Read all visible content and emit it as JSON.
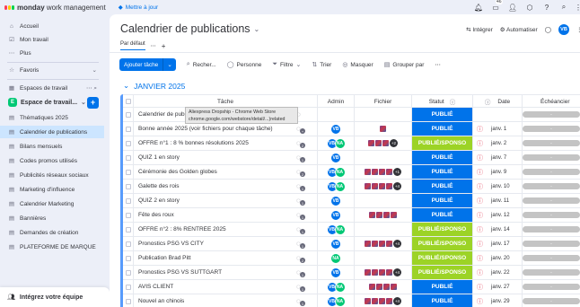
{
  "app": {
    "brand": "monday",
    "brand_suffix": "work management",
    "upgrade": "Mettre à jour",
    "inbox_count": "46"
  },
  "sidebar": {
    "top": [
      {
        "label": "Accueil",
        "icon": "home-icon"
      },
      {
        "label": "Mon travail",
        "icon": "calendar-check-icon"
      },
      {
        "label": "Plus",
        "icon": "more-icon"
      }
    ],
    "favorites": "Favoris",
    "workspaces": "Espaces de travail",
    "workspace_name": "Espace de travail...",
    "workspace_letter": "E",
    "boards": [
      "Thématiques 2025",
      "Calendrier de publications",
      "Bilans mensuels",
      "Codes promos utilisés",
      "Publicités réseaux sociaux",
      "Marketing d'influence",
      "Calendrier Marketing",
      "Bannières",
      "Demandes de création",
      "PLATEFORME DE MARQUE"
    ],
    "active_index": 1,
    "integrate": "Intégrez votre équipe"
  },
  "board": {
    "title": "Calendrier de publications",
    "integrate": "Intégrer",
    "automate": "Automatiser",
    "user_initials": "VB",
    "view_tab": "Par défaut",
    "add_item": "Ajouter tâche",
    "search": "Recher...",
    "person": "Personne",
    "filter": "Filtre",
    "sort": "Trier",
    "hide": "Masquer",
    "group_by": "Grouper par",
    "group_title": "JANVIER 2025",
    "columns": {
      "task": "Tâche",
      "admin": "Admin",
      "file": "Fichier",
      "status": "Statut",
      "date": "Date",
      "timeline": "Échéancier"
    }
  },
  "tooltip": {
    "line1": "Aliexpress Dropship - Chrome Web Store",
    "line2": "chrome.google.com/webstore/detail/...)related"
  },
  "rows": [
    {
      "task": "Calendrier de publications 2025(voir fichiers)",
      "admin": [],
      "files": 0,
      "extra": "",
      "status": "PUBLIÉ",
      "kind": "pub",
      "date": "",
      "updates": ""
    },
    {
      "task": "Bonne année 2025 (voir fichiers pour chaque tâche)",
      "admin": [
        "VB"
      ],
      "files": 1,
      "extra": "",
      "status": "PUBLIÉ",
      "kind": "pub",
      "date": "janv. 1",
      "updates": "+"
    },
    {
      "task": "OFFRE n°1 : 8 % bonnes résolutions 2025",
      "admin": [
        "VB",
        "NA"
      ],
      "files": 3,
      "extra": "+2",
      "status": "PUBLIÉ/SPONSO",
      "kind": "spon",
      "date": "janv. 2",
      "updates": "2"
    },
    {
      "task": "QUIZ 1 en story",
      "admin": [
        "VB"
      ],
      "files": 0,
      "extra": "",
      "status": "PUBLIÉ",
      "kind": "pub",
      "date": "janv. 7",
      "updates": "1"
    },
    {
      "task": "Cérémonie des Golden globes",
      "admin": [
        "VB",
        "NA"
      ],
      "files": 4,
      "extra": "+1",
      "status": "PUBLIÉ",
      "kind": "pub",
      "date": "janv. 9",
      "updates": "2"
    },
    {
      "task": "Galette des rois",
      "admin": [
        "VB",
        "NA"
      ],
      "files": 4,
      "extra": "+4",
      "status": "PUBLIÉ",
      "kind": "pub",
      "date": "janv. 10",
      "updates": "1"
    },
    {
      "task": "QUIZ 2 en story",
      "admin": [
        "VB"
      ],
      "files": 0,
      "extra": "",
      "status": "PUBLIÉ",
      "kind": "pub",
      "date": "janv. 11",
      "updates": "1"
    },
    {
      "task": "Fête des roux",
      "admin": [
        "VB"
      ],
      "files": 4,
      "extra": "",
      "status": "PUBLIÉ",
      "kind": "pub",
      "date": "janv. 12",
      "updates": "1"
    },
    {
      "task": "OFFRE n°2 : 8% RENTRÉE 2025",
      "admin": [
        "VB",
        "NA"
      ],
      "files": 0,
      "extra": "",
      "status": "PUBLIÉ/SPONSO",
      "kind": "spon",
      "date": "janv. 14",
      "updates": "1"
    },
    {
      "task": "Pronostics PSG VS CITY",
      "admin": [
        "VB"
      ],
      "files": 4,
      "extra": "+4",
      "status": "PUBLIÉ/SPONSO",
      "kind": "spon",
      "date": "janv. 17",
      "updates": "1"
    },
    {
      "task": "Publication Brad Pitt",
      "admin": [
        "NA"
      ],
      "files": 0,
      "extra": "",
      "status": "PUBLIÉ/SPONSO",
      "kind": "spon",
      "date": "janv. 20",
      "updates": "2"
    },
    {
      "task": "Pronostics PSG VS SUTTGART",
      "admin": [
        "VB"
      ],
      "files": 4,
      "extra": "+4",
      "status": "PUBLIÉ/SPONSO",
      "kind": "spon",
      "date": "janv. 22",
      "updates": "1"
    },
    {
      "task": "AVIS CLIENT",
      "admin": [
        "VB",
        "NA"
      ],
      "files": 4,
      "extra": "",
      "status": "PUBLIÉ",
      "kind": "pub",
      "date": "janv. 27",
      "updates": "1"
    },
    {
      "task": "Nouvel an chinois",
      "admin": [
        "VB",
        "NA"
      ],
      "files": 4,
      "extra": "+4",
      "status": "PUBLIÉ",
      "kind": "pub",
      "date": "janv. 29",
      "updates": "1"
    }
  ],
  "timeline_placeholder": "-",
  "colors": {
    "primary": "#0073ea",
    "published": "#0073ea",
    "sponsored": "#9cd326",
    "alert": "#e2445c",
    "group": "#579bfc"
  }
}
